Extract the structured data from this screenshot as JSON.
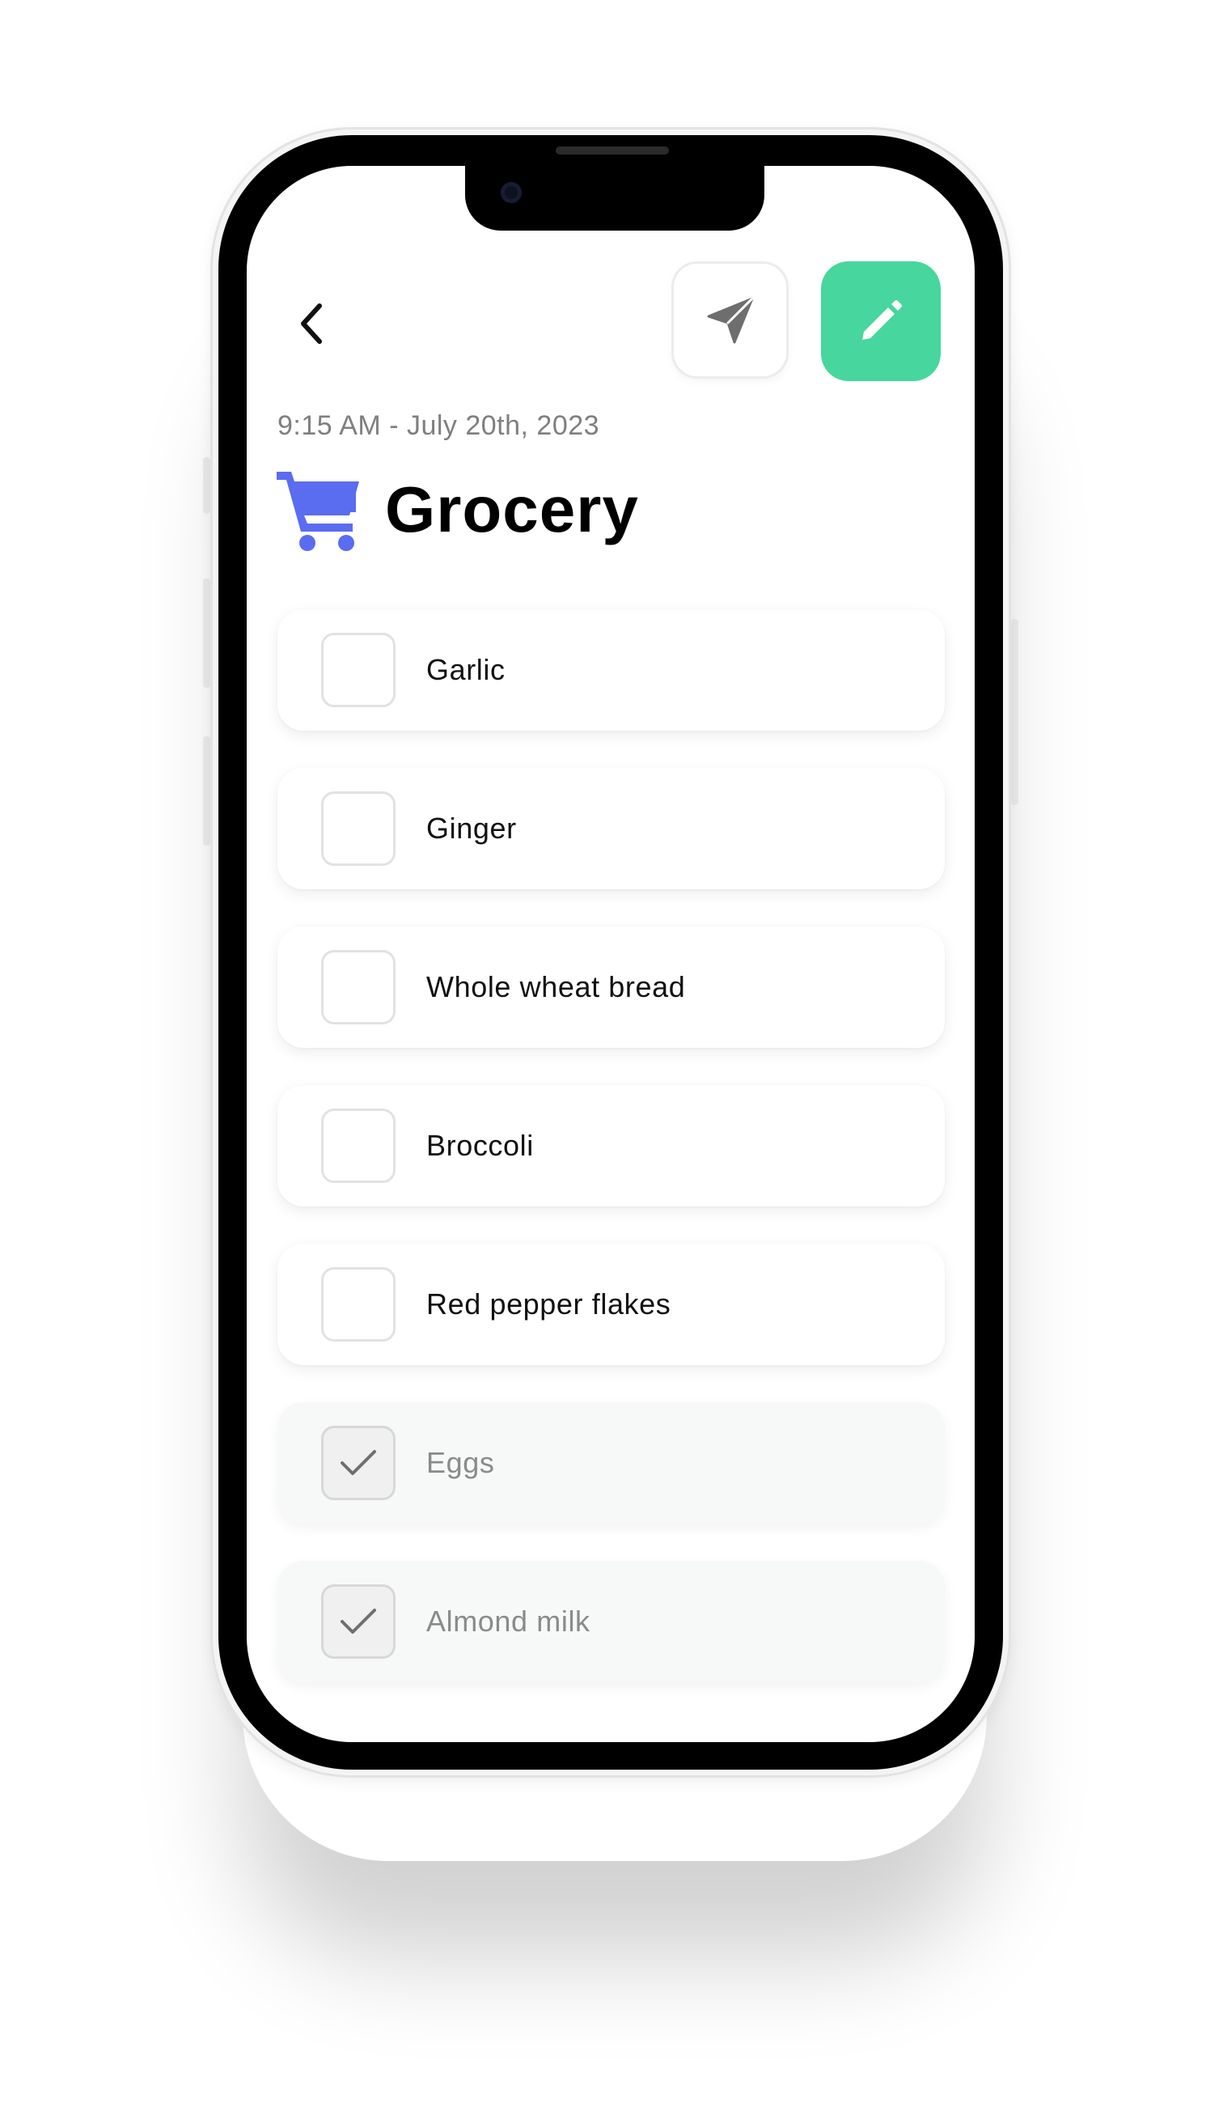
{
  "header": {
    "back_icon": "chevron-left-icon",
    "send_icon": "send-icon",
    "edit_icon": "pencil-icon",
    "accent_color": "#47d69e"
  },
  "list_meta": {
    "timestamp": "9:15 AM - July 20th, 2023",
    "title": "Grocery",
    "icon": "shopping-cart-icon",
    "icon_color": "#5a6cf0"
  },
  "items": [
    {
      "label": "Garlic",
      "checked": false
    },
    {
      "label": "Ginger",
      "checked": false
    },
    {
      "label": "Whole wheat bread",
      "checked": false
    },
    {
      "label": "Broccoli",
      "checked": false
    },
    {
      "label": "Red pepper flakes",
      "checked": false
    },
    {
      "label": "Eggs",
      "checked": true
    },
    {
      "label": "Almond milk",
      "checked": true
    }
  ]
}
